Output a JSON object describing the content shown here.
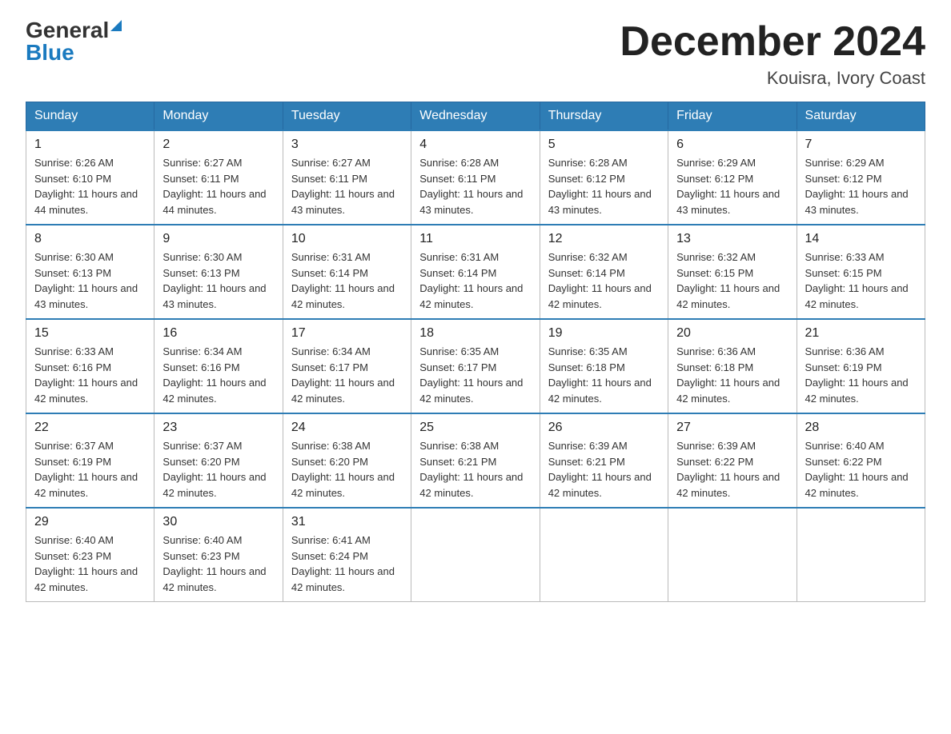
{
  "logo": {
    "general": "General",
    "triangle": "▶",
    "blue": "Blue"
  },
  "title": {
    "month_year": "December 2024",
    "location": "Kouisra, Ivory Coast"
  },
  "headers": [
    "Sunday",
    "Monday",
    "Tuesday",
    "Wednesday",
    "Thursday",
    "Friday",
    "Saturday"
  ],
  "weeks": [
    [
      {
        "day": "1",
        "sunrise": "6:26 AM",
        "sunset": "6:10 PM",
        "daylight": "11 hours and 44 minutes."
      },
      {
        "day": "2",
        "sunrise": "6:27 AM",
        "sunset": "6:11 PM",
        "daylight": "11 hours and 44 minutes."
      },
      {
        "day": "3",
        "sunrise": "6:27 AM",
        "sunset": "6:11 PM",
        "daylight": "11 hours and 43 minutes."
      },
      {
        "day": "4",
        "sunrise": "6:28 AM",
        "sunset": "6:11 PM",
        "daylight": "11 hours and 43 minutes."
      },
      {
        "day": "5",
        "sunrise": "6:28 AM",
        "sunset": "6:12 PM",
        "daylight": "11 hours and 43 minutes."
      },
      {
        "day": "6",
        "sunrise": "6:29 AM",
        "sunset": "6:12 PM",
        "daylight": "11 hours and 43 minutes."
      },
      {
        "day": "7",
        "sunrise": "6:29 AM",
        "sunset": "6:12 PM",
        "daylight": "11 hours and 43 minutes."
      }
    ],
    [
      {
        "day": "8",
        "sunrise": "6:30 AM",
        "sunset": "6:13 PM",
        "daylight": "11 hours and 43 minutes."
      },
      {
        "day": "9",
        "sunrise": "6:30 AM",
        "sunset": "6:13 PM",
        "daylight": "11 hours and 43 minutes."
      },
      {
        "day": "10",
        "sunrise": "6:31 AM",
        "sunset": "6:14 PM",
        "daylight": "11 hours and 42 minutes."
      },
      {
        "day": "11",
        "sunrise": "6:31 AM",
        "sunset": "6:14 PM",
        "daylight": "11 hours and 42 minutes."
      },
      {
        "day": "12",
        "sunrise": "6:32 AM",
        "sunset": "6:14 PM",
        "daylight": "11 hours and 42 minutes."
      },
      {
        "day": "13",
        "sunrise": "6:32 AM",
        "sunset": "6:15 PM",
        "daylight": "11 hours and 42 minutes."
      },
      {
        "day": "14",
        "sunrise": "6:33 AM",
        "sunset": "6:15 PM",
        "daylight": "11 hours and 42 minutes."
      }
    ],
    [
      {
        "day": "15",
        "sunrise": "6:33 AM",
        "sunset": "6:16 PM",
        "daylight": "11 hours and 42 minutes."
      },
      {
        "day": "16",
        "sunrise": "6:34 AM",
        "sunset": "6:16 PM",
        "daylight": "11 hours and 42 minutes."
      },
      {
        "day": "17",
        "sunrise": "6:34 AM",
        "sunset": "6:17 PM",
        "daylight": "11 hours and 42 minutes."
      },
      {
        "day": "18",
        "sunrise": "6:35 AM",
        "sunset": "6:17 PM",
        "daylight": "11 hours and 42 minutes."
      },
      {
        "day": "19",
        "sunrise": "6:35 AM",
        "sunset": "6:18 PM",
        "daylight": "11 hours and 42 minutes."
      },
      {
        "day": "20",
        "sunrise": "6:36 AM",
        "sunset": "6:18 PM",
        "daylight": "11 hours and 42 minutes."
      },
      {
        "day": "21",
        "sunrise": "6:36 AM",
        "sunset": "6:19 PM",
        "daylight": "11 hours and 42 minutes."
      }
    ],
    [
      {
        "day": "22",
        "sunrise": "6:37 AM",
        "sunset": "6:19 PM",
        "daylight": "11 hours and 42 minutes."
      },
      {
        "day": "23",
        "sunrise": "6:37 AM",
        "sunset": "6:20 PM",
        "daylight": "11 hours and 42 minutes."
      },
      {
        "day": "24",
        "sunrise": "6:38 AM",
        "sunset": "6:20 PM",
        "daylight": "11 hours and 42 minutes."
      },
      {
        "day": "25",
        "sunrise": "6:38 AM",
        "sunset": "6:21 PM",
        "daylight": "11 hours and 42 minutes."
      },
      {
        "day": "26",
        "sunrise": "6:39 AM",
        "sunset": "6:21 PM",
        "daylight": "11 hours and 42 minutes."
      },
      {
        "day": "27",
        "sunrise": "6:39 AM",
        "sunset": "6:22 PM",
        "daylight": "11 hours and 42 minutes."
      },
      {
        "day": "28",
        "sunrise": "6:40 AM",
        "sunset": "6:22 PM",
        "daylight": "11 hours and 42 minutes."
      }
    ],
    [
      {
        "day": "29",
        "sunrise": "6:40 AM",
        "sunset": "6:23 PM",
        "daylight": "11 hours and 42 minutes."
      },
      {
        "day": "30",
        "sunrise": "6:40 AM",
        "sunset": "6:23 PM",
        "daylight": "11 hours and 42 minutes."
      },
      {
        "day": "31",
        "sunrise": "6:41 AM",
        "sunset": "6:24 PM",
        "daylight": "11 hours and 42 minutes."
      },
      null,
      null,
      null,
      null
    ]
  ]
}
